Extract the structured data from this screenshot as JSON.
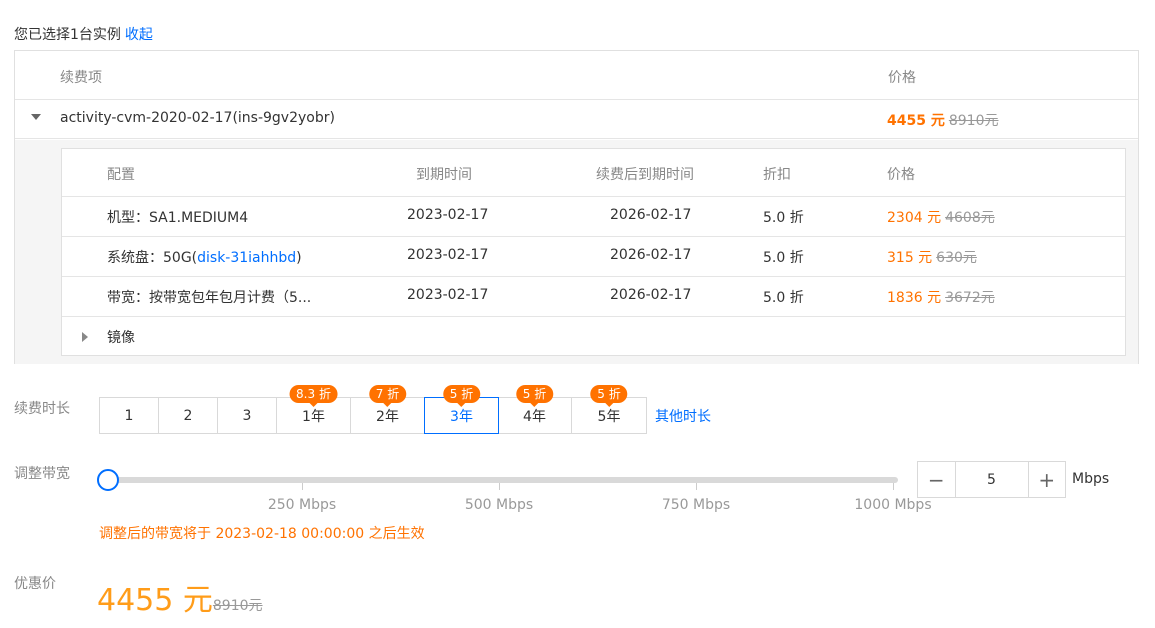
{
  "selected": {
    "text": "您已选择1台实例",
    "collapse": "收起"
  },
  "outer": {
    "head": {
      "item": "续费项",
      "price": "价格"
    },
    "instance": {
      "name": "activity-cvm-2020-02-17(ins-9gv2yobr)",
      "price_now": "4455 元",
      "price_old": "8910元"
    }
  },
  "inner": {
    "head": {
      "config": "配置",
      "expire": "到期时间",
      "after": "续费后到期时间",
      "discount": "折扣",
      "price": "价格"
    },
    "rows": [
      {
        "label": "机型：SA1.MEDIUM4",
        "expire": "2023-02-17",
        "after": "2026-02-17",
        "discount": "5.0 折",
        "price_now": "2304 元",
        "price_old": "4608元"
      },
      {
        "label_prefix": "系统盘：50G(",
        "link": "disk-31iahhbd",
        "label_suffix": ")",
        "expire": "2023-02-17",
        "after": "2026-02-17",
        "discount": "5.0 折",
        "price_now": "315 元",
        "price_old": "630元"
      },
      {
        "label": "带宽：按带宽包年包月计费（5...",
        "expire": "2023-02-17",
        "after": "2026-02-17",
        "discount": "5.0 折",
        "price_now": "1836 元",
        "price_old": "3672元"
      }
    ],
    "image_row": "镜像"
  },
  "duration": {
    "label": "续费时长",
    "options": [
      {
        "label": "1",
        "badge": ""
      },
      {
        "label": "2",
        "badge": ""
      },
      {
        "label": "3",
        "badge": ""
      },
      {
        "label": "1年",
        "badge": "8.3 折"
      },
      {
        "label": "2年",
        "badge": "7 折"
      },
      {
        "label": "3年",
        "badge": "5 折"
      },
      {
        "label": "4年",
        "badge": "5 折"
      },
      {
        "label": "5年",
        "badge": "5 折"
      }
    ],
    "selected": "3年",
    "other": "其他时长"
  },
  "bandwidth": {
    "label": "调整带宽",
    "ticks": [
      "250 Mbps",
      "500 Mbps",
      "750 Mbps",
      "1000 Mbps"
    ],
    "value": "5",
    "unit": "Mbps",
    "minus": "−",
    "plus": "+",
    "note": "调整后的带宽将于 2023-02-18 00:00:00 之后生效"
  },
  "discount_price": {
    "label": "优惠价",
    "now": "4455 元",
    "old": "8910元"
  },
  "colors": {
    "accent": "#006eff",
    "price": "#ff7200",
    "final_price": "#ff9c19"
  }
}
